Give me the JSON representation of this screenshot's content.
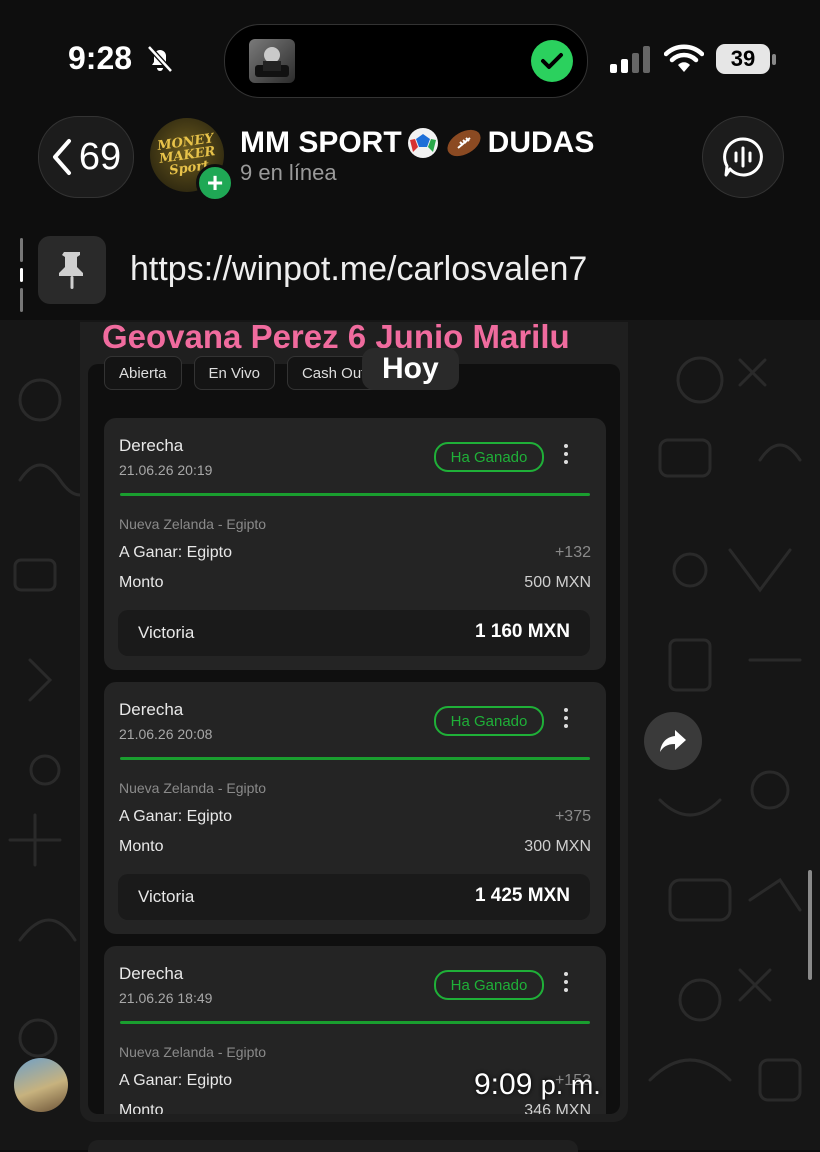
{
  "status_bar": {
    "time": "9:28",
    "battery": "39"
  },
  "header": {
    "back_count": "69",
    "group_name": "MM SPORT",
    "group_name_suffix": "DUDAS",
    "group_emojis": [
      "soccer-ball-icon",
      "football-icon"
    ],
    "subtitle": "9 en línea",
    "avatar_text_1": "MONEY",
    "avatar_text_2": "MAKER",
    "avatar_text_3": "Sport"
  },
  "pinned": {
    "text": "https://winpot.me/carlosvalen7"
  },
  "date_chip": "Hoy",
  "message": {
    "headline": "Geovana Perez 6 Junio Marilu",
    "tabs": [
      "Abierta",
      "En Vivo",
      "Cash Out"
    ],
    "cards": [
      {
        "type": "Derecha",
        "date": "21.06.26 20:19",
        "status": "Ha Ganado",
        "match": "Nueva Zelanda - Egipto",
        "pick_label": "A Ganar:",
        "pick_value": "Egipto",
        "odds": "+132",
        "amount_label": "Monto",
        "amount": "500 MXN",
        "win_label": "Victoria",
        "win_amount": "1 160 MXN"
      },
      {
        "type": "Derecha",
        "date": "21.06.26 20:08",
        "status": "Ha Ganado",
        "match": "Nueva Zelanda - Egipto",
        "pick_label": "A Ganar:",
        "pick_value": "Egipto",
        "odds": "+375",
        "amount_label": "Monto",
        "amount": "300 MXN",
        "win_label": "Victoria",
        "win_amount": "1 425 MXN"
      },
      {
        "type": "Derecha",
        "date": "21.06.26 18:49",
        "status": "Ha Ganado",
        "match": "Nueva Zelanda - Egipto",
        "pick_label": "A Ganar:",
        "pick_value": "Egipto",
        "odds": "+153",
        "amount_label": "Monto",
        "amount": "346 MXN",
        "win_label": "",
        "win_amount": ""
      }
    ],
    "time": "9:09",
    "time_suffix": "p. m."
  },
  "colors": {
    "win_green": "#1fb038",
    "headline_pink": "#f06b9e",
    "online_green": "#1fa855"
  }
}
